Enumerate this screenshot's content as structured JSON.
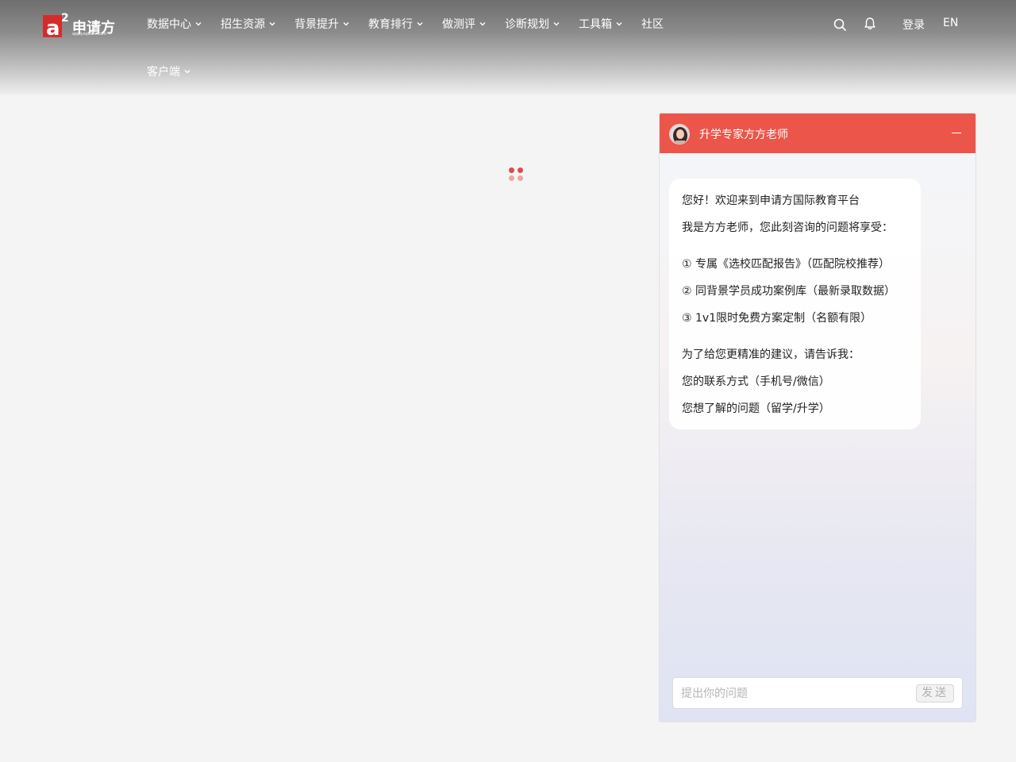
{
  "header": {
    "logo": {
      "brand": "申请方",
      "domain": "applysquare.com",
      "mark": "a2"
    },
    "nav": [
      {
        "label": "数据中心",
        "has_dropdown": true
      },
      {
        "label": "招生资源",
        "has_dropdown": true
      },
      {
        "label": "背景提升",
        "has_dropdown": true
      },
      {
        "label": "教育排行",
        "has_dropdown": true
      },
      {
        "label": "做测评",
        "has_dropdown": true
      },
      {
        "label": "诊断规划",
        "has_dropdown": true
      },
      {
        "label": "工具箱",
        "has_dropdown": true
      },
      {
        "label": "社区",
        "has_dropdown": false
      },
      {
        "label": "客户端",
        "has_dropdown": true
      }
    ],
    "icons": {
      "search": "search-icon",
      "notification": "bell-icon"
    },
    "login_label": "登录",
    "lang_label": "EN"
  },
  "loader": {
    "colors": [
      "#e04a45",
      "#e04a45",
      "#f0a4a2",
      "#f0a4a2"
    ]
  },
  "chat": {
    "title": "升学专家方方老师",
    "header_color": "#ec5549",
    "greeting": {
      "line1": "您好！欢迎来到申请方国际教育平台",
      "line2": "我是方方老师，您此刻咨询的问题将享受：",
      "benefits": [
        "① 专属《选校匹配报告》（匹配院校推荐）",
        "② 同背景学员成功案例库（最新录取数据）",
        "③ 1v1限时免费方案定制（名额有限）"
      ],
      "ask_intro": "为了给您更精准的建议，请告诉我：",
      "asks": [
        "您的联系方式（手机号/微信）",
        "您想了解的问题（留学/升学）"
      ]
    },
    "input_placeholder": "提出你的问题",
    "send_label": "发送"
  }
}
